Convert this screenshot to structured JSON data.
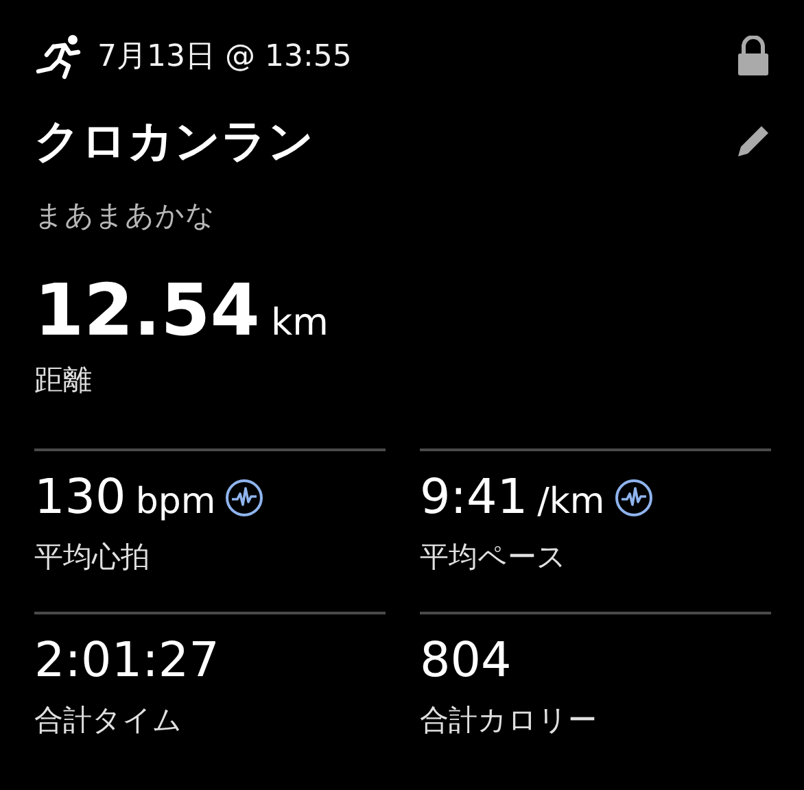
{
  "header": {
    "date": "7月13日 @ 13:55",
    "locked": true
  },
  "title": "クロカンラン",
  "note": "まあまあかな",
  "distance": {
    "value": "12.54",
    "unit": "km",
    "label": "距離"
  },
  "stats": [
    {
      "value": "130",
      "unit": "bpm",
      "label": "平均心拍",
      "has_graph": true
    },
    {
      "value": "9:41",
      "unit": "/km",
      "label": "平均ペース",
      "has_graph": true
    },
    {
      "value": "2:01:27",
      "label": "合計タイム",
      "has_graph": false
    },
    {
      "value": "804",
      "label": "合計カロリー",
      "has_graph": false
    }
  ]
}
